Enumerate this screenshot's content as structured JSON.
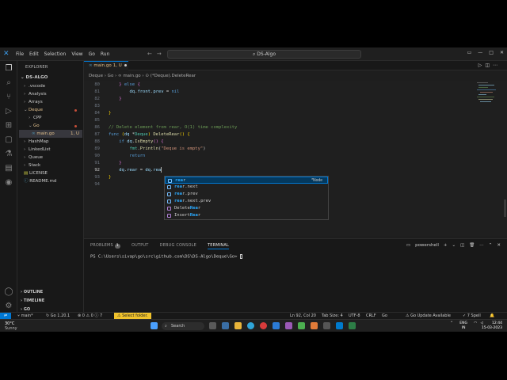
{
  "titlebar": {
    "menu": [
      "File",
      "Edit",
      "Selection",
      "View",
      "Go",
      "Run"
    ],
    "command_center": "DS-Algo"
  },
  "sidebar": {
    "header": "EXPLORER",
    "root": "DS-ALGO",
    "items": [
      {
        "label": ".vscode",
        "indent": 1,
        "chevron": "›"
      },
      {
        "label": "Analysis",
        "indent": 1,
        "chevron": "›"
      },
      {
        "label": "Arrays",
        "indent": 1,
        "chevron": "›"
      },
      {
        "label": "Deque",
        "indent": 1,
        "chevron": "⌄"
      },
      {
        "label": "CPP",
        "indent": 2,
        "chevron": "›"
      },
      {
        "label": "Go",
        "indent": 2,
        "chevron": "⌄"
      },
      {
        "label": "main.go",
        "indent": 3,
        "chevron": "",
        "badge": "1, U"
      },
      {
        "label": "HashMap",
        "indent": 1,
        "chevron": "›"
      },
      {
        "label": "LinkedList",
        "indent": 1,
        "chevron": "›"
      },
      {
        "label": "Queue",
        "indent": 1,
        "chevron": "›"
      },
      {
        "label": "Stack",
        "indent": 1,
        "chevron": "›"
      },
      {
        "label": "LICENSE",
        "indent": 1,
        "chevron": ""
      },
      {
        "label": "README.md",
        "indent": 1,
        "chevron": ""
      }
    ],
    "bottom_sections": [
      "OUTLINE",
      "TIMELINE",
      "GO"
    ]
  },
  "tab": {
    "label": "main.go",
    "status": "1, U"
  },
  "breadcrumbs": "Deque › Go › ∞ main.go › ⊙ (*Deque).DeleteRear",
  "editor": {
    "line_numbers": [
      "80",
      "81",
      "82",
      "83",
      "84",
      "85",
      "86",
      "87",
      "88",
      "89",
      "90",
      "91",
      "92",
      "93",
      "94"
    ],
    "current_line": "92"
  },
  "suggest": {
    "items": [
      {
        "pre": "",
        "hl": "rea",
        "post": "r",
        "detail": "*Node"
      },
      {
        "pre": "",
        "hl": "rea",
        "post": "r.next",
        "detail": ""
      },
      {
        "pre": "",
        "hl": "rea",
        "post": "r.prev",
        "detail": ""
      },
      {
        "pre": "",
        "hl": "rea",
        "post": "r.next.prev",
        "detail": ""
      },
      {
        "pre": "Delete",
        "hl": "Rea",
        "post": "r",
        "detail": ""
      },
      {
        "pre": "Insert",
        "hl": "Rea",
        "post": "r",
        "detail": ""
      }
    ]
  },
  "panel": {
    "tabs": [
      "PROBLEMS",
      "OUTPUT",
      "DEBUG CONSOLE",
      "TERMINAL"
    ],
    "problems_count": "1",
    "active_tab": "TERMINAL",
    "shell": "powershell",
    "terminal_prompt": "PS C:\\Users\\sivap\\go\\src\\github.com\\DS\\DS-Algo\\Deque\\Go> "
  },
  "statusbar": {
    "branch": "main*",
    "go_version": "Go 1.20.1",
    "errors": "0",
    "warnings": "0",
    "info": "7",
    "select_folder": "Select folder.",
    "position": "Ln 92, Col 20",
    "tab_size": "Tab Size: 4",
    "encoding": "UTF-8",
    "eol": "CRLF",
    "language": "Go",
    "go_update": "Go Update Available",
    "spell": "7 Spell"
  },
  "taskbar": {
    "temperature": "30°C",
    "weather": "Sunny",
    "search": "Search",
    "lang_top": "ENG",
    "lang_bottom": "IN",
    "time": "12:44",
    "date": "15-03-2023"
  },
  "colors": {
    "accent": "#0078d4",
    "select_folder_bg": "#f0c22c"
  }
}
